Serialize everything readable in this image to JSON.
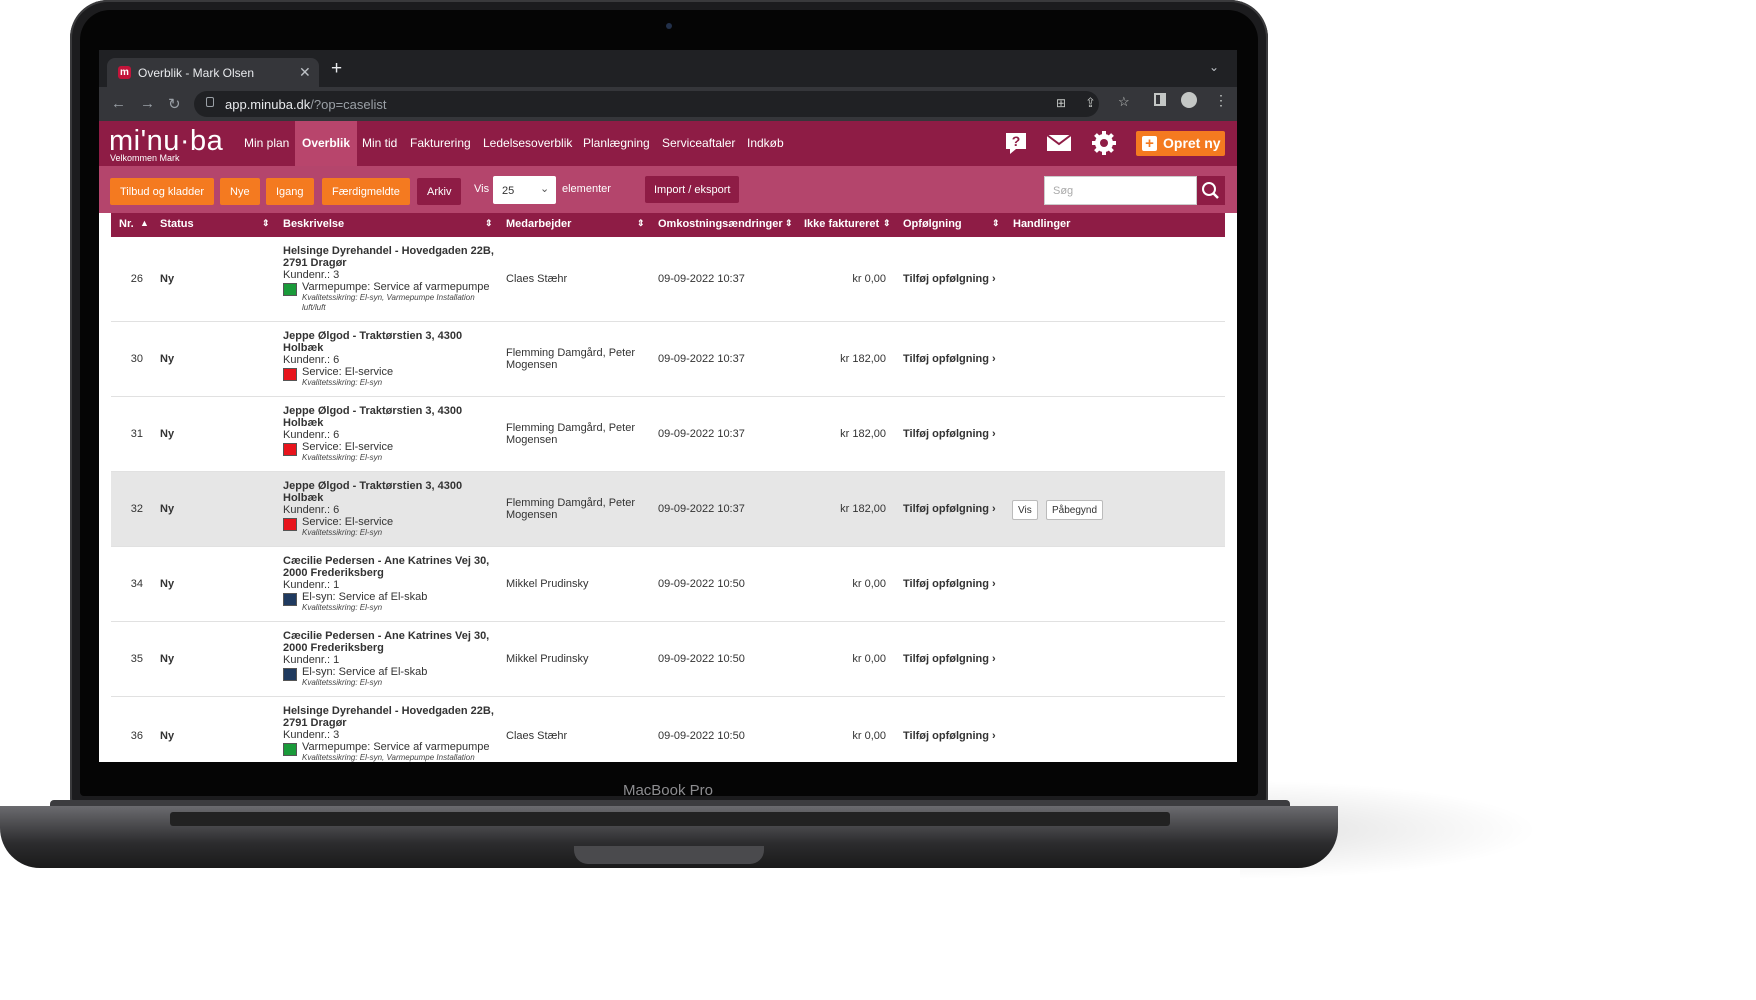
{
  "device": {
    "brand_label": "MacBook Pro"
  },
  "browser": {
    "tab_title": "Overblik - Mark Olsen",
    "favicon_letter": "m",
    "url_host": "app.minuba.dk",
    "url_path": "/?op=caselist"
  },
  "app": {
    "logo": "mi'nu·ba",
    "welcome": "Velkommen  Mark",
    "nav": [
      "Min plan",
      "Overblik",
      "Min tid",
      "Fakturering",
      "Ledelsesoverblik",
      "Planlægning",
      "Serviceaftaler",
      "Indkøb"
    ],
    "active_nav": "Overblik",
    "create_label": "Opret ny"
  },
  "filters": {
    "buttons": [
      "Tilbud og kladder",
      "Nye",
      "Igang",
      "Færdigmeldte",
      "Arkiv"
    ],
    "vis_label": "Vis",
    "page_size": "25",
    "elements_label": "elementer",
    "import_label": "Import / eksport",
    "search_placeholder": "Søg"
  },
  "table": {
    "columns": [
      "Nr.",
      "Status",
      "Beskrivelse",
      "Medarbejder",
      "Omkostningsændringer",
      "Ikke faktureret",
      "Opfølgning",
      "Handlinger"
    ],
    "followup_label": "Tilføj opfølgning",
    "action_view": "Vis",
    "action_start": "Påbegynd",
    "rows": [
      {
        "nr": "26",
        "status": "Ny",
        "addr1": "Helsinge Dyrehandel - Hovedgaden 22B,",
        "addr2": "2791 Dragør",
        "kundenr": "Kundenr.: 3",
        "service": "Varmepumpe: Service af varmepumpe",
        "kval": "Kvalitetssikring: El-syn, Varmepumpe Installation luft/luft",
        "color": "#1a9a3a",
        "employee": "Claes Stæhr",
        "date": "09-09-2022 10:37",
        "amount": "kr 0,00"
      },
      {
        "nr": "30",
        "status": "Ny",
        "addr1": "Jeppe Ølgod - Traktørstien 3, 4300",
        "addr2": "Holbæk",
        "kundenr": "Kundenr.: 6",
        "service": "Service: El-service",
        "kval": "Kvalitetssikring: El-syn",
        "color": "#e8141c",
        "employee": "Flemming Damgård, Peter Mogensen",
        "date": "09-09-2022 10:37",
        "amount": "kr 182,00"
      },
      {
        "nr": "31",
        "status": "Ny",
        "addr1": "Jeppe Ølgod - Traktørstien 3, 4300",
        "addr2": "Holbæk",
        "kundenr": "Kundenr.: 6",
        "service": "Service: El-service",
        "kval": "Kvalitetssikring: El-syn",
        "color": "#e8141c",
        "employee": "Flemming Damgård, Peter Mogensen",
        "date": "09-09-2022 10:37",
        "amount": "kr 182,00"
      },
      {
        "nr": "32",
        "status": "Ny",
        "addr1": "Jeppe Ølgod - Traktørstien 3, 4300",
        "addr2": "Holbæk",
        "kundenr": "Kundenr.: 6",
        "service": "Service: El-service",
        "kval": "Kvalitetssikring: El-syn",
        "color": "#e8141c",
        "employee": "Flemming Damgård, Peter Mogensen",
        "date": "09-09-2022 10:37",
        "amount": "kr 182,00",
        "highlighted": true
      },
      {
        "nr": "34",
        "status": "Ny",
        "addr1": "Cæcilie Pedersen - Ane Katrines Vej 30,",
        "addr2": "2000 Frederiksberg",
        "kundenr": "Kundenr.: 1",
        "service": "El-syn: Service af El-skab",
        "kval": "Kvalitetssikring: El-syn",
        "color": "#1f3a5f",
        "employee": "Mikkel Prudinsky",
        "date": "09-09-2022 10:50",
        "amount": "kr 0,00"
      },
      {
        "nr": "35",
        "status": "Ny",
        "addr1": "Cæcilie Pedersen - Ane Katrines Vej 30,",
        "addr2": "2000 Frederiksberg",
        "kundenr": "Kundenr.: 1",
        "service": "El-syn: Service af El-skab",
        "kval": "Kvalitetssikring: El-syn",
        "color": "#1f3a5f",
        "employee": "Mikkel Prudinsky",
        "date": "09-09-2022 10:50",
        "amount": "kr 0,00"
      },
      {
        "nr": "36",
        "status": "Ny",
        "addr1": "Helsinge Dyrehandel - Hovedgaden 22B,",
        "addr2": "2791 Dragør",
        "kundenr": "Kundenr.: 3",
        "service": "Varmepumpe: Service af varmepumpe",
        "kval": "Kvalitetssikring: El-syn, Varmepumpe Installation",
        "color": "#1a9a3a",
        "employee": "Claes Stæhr",
        "date": "09-09-2022 10:50",
        "amount": "kr 0,00"
      }
    ]
  }
}
